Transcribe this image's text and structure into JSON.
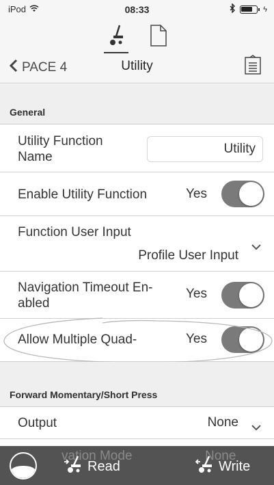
{
  "status_bar": {
    "carrier": "iPod",
    "time": "08:33"
  },
  "nav": {
    "back_label": "PACE 4",
    "title": "Utility"
  },
  "sections": {
    "general": "General",
    "forward": "Forward Momentary/Short Press"
  },
  "rows": {
    "function_name": {
      "label": "Utility Function Name",
      "value": "Utility"
    },
    "enable": {
      "label": "Enable Utility Function",
      "value": "Yes",
      "toggle_on": true
    },
    "user_input": {
      "label": "Function User Input",
      "value": "Profile User Input"
    },
    "nav_timeout": {
      "label": "Navigation Timeout En-abled",
      "value": "Yes",
      "toggle_on": true
    },
    "multi_quad": {
      "label": "Allow Multiple Quad-",
      "value": "Yes",
      "toggle_on": true
    },
    "output": {
      "label": "Output",
      "value": "None"
    },
    "activation_mode": {
      "label": "vation Mode",
      "value": "None"
    }
  },
  "toolbar": {
    "read_label": "Read",
    "write_label": "Write"
  },
  "colors": {
    "toggle_on": "#7a7a7a",
    "toolbar_bg": "#464646",
    "section_bg": "#efefef",
    "bar_bg": "#f6f6f6"
  }
}
